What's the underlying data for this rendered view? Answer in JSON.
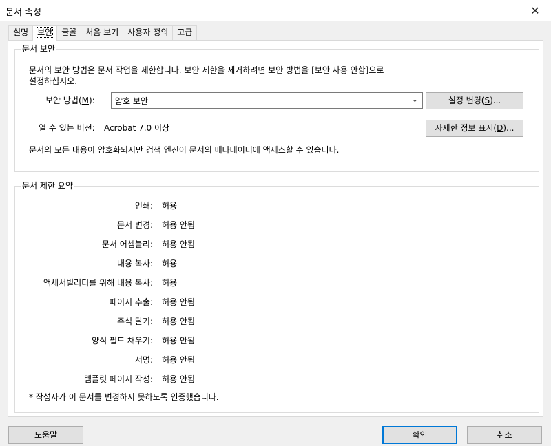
{
  "window": {
    "title": "문서 속성",
    "close_icon": "✕"
  },
  "tabs": [
    "설명",
    "보안",
    "글꼴",
    "처음 보기",
    "사용자 정의",
    "고급"
  ],
  "security_group": {
    "label": "문서 보안",
    "description": "문서의 보안 방법은 문서 작업을 제한합니다. 보안 제한을 제거하려면 보안 방법을 [보안 사용 안함]으로 설정하십시오.",
    "method_label": "보안 방법(",
    "method_mnemonic": "M",
    "method_suffix": "):",
    "method_value": "암호 보안",
    "change_settings_button": {
      "prefix": "설정 변경(",
      "mnemonic": "S",
      "suffix": ")..."
    },
    "version_label": "열 수 있는 버전:",
    "version_value": "Acrobat 7.0 이상",
    "show_details_button": {
      "prefix": "자세한 정보 표시(",
      "mnemonic": "D",
      "suffix": ")..."
    },
    "encryption_note": "문서의 모든 내용이 암호화되지만 검색 엔진이 문서의 메타데이터에 액세스할 수 있습니다."
  },
  "restrictions_group": {
    "label": "문서 제한 요약",
    "rows": [
      {
        "label": "인쇄:",
        "value": "허용"
      },
      {
        "label": "문서 변경:",
        "value": "허용 안됨"
      },
      {
        "label": "문서 어셈블리:",
        "value": "허용 안됨"
      },
      {
        "label": "내용 복사:",
        "value": "허용"
      },
      {
        "label": "액세서빌러티를 위해 내용 복사:",
        "value": "허용"
      },
      {
        "label": "페이지 추출:",
        "value": "허용 안됨"
      },
      {
        "label": "주석 달기:",
        "value": "허용 안됨"
      },
      {
        "label": "양식 필드 채우기:",
        "value": "허용 안됨"
      },
      {
        "label": "서명:",
        "value": "허용 안됨"
      },
      {
        "label": "템플릿 페이지 작성:",
        "value": "허용 안됨"
      }
    ],
    "footnote": "*  작성자가 이 문서를 변경하지 못하도록 인증했습니다."
  },
  "footer": {
    "help": "도움말",
    "ok": "확인",
    "cancel": "취소"
  },
  "colors": {
    "accent": "#0078d7"
  }
}
